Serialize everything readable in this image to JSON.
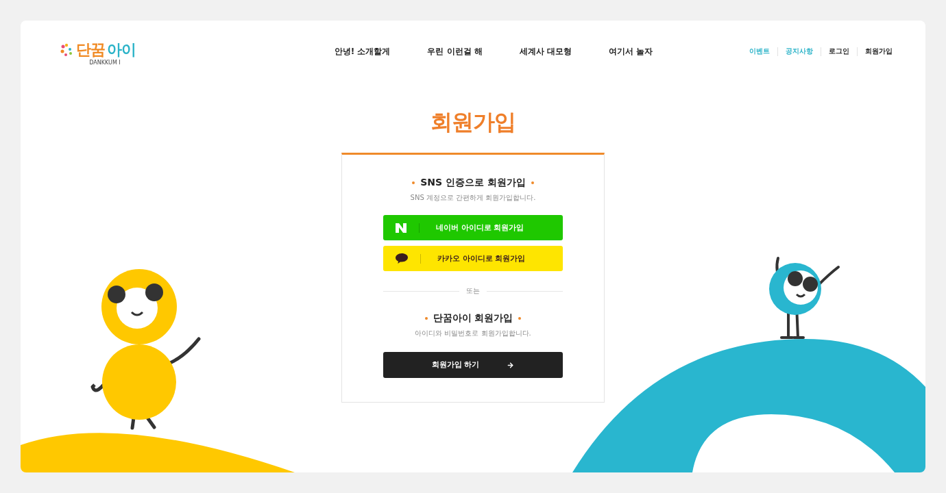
{
  "logo": {
    "word_1": "단꿈",
    "word_2": "아이",
    "sub": "DANKKUM I"
  },
  "nav": [
    "안녕! 소개할게",
    "우린 이런걸 해",
    "세계사 대모형",
    "여기서 놀자"
  ],
  "util_links": [
    {
      "label": "이벤트",
      "color": "#2bb3c8"
    },
    {
      "label": "공지사항",
      "color": "#2bb3c8"
    },
    {
      "label": "로그인",
      "color": "#222222"
    },
    {
      "label": "회원가입",
      "color": "#222222"
    }
  ],
  "page_title": "회원가입",
  "sns_section": {
    "title": "SNS 인증으로 회원가입",
    "description": "SNS 계정으로 간편하게 회원가입합니다.",
    "buttons": [
      {
        "kind": "naver",
        "label": "네이버 아이디로 회원가입"
      },
      {
        "kind": "kakao",
        "label": "카카오 아이디로 회원가입"
      }
    ]
  },
  "divider_text": "또는",
  "member_section": {
    "title": "단꿈아이 회원가입",
    "description": "아이디와 비밀번호로 회원가입합니다.",
    "button": "회원가입 하기"
  }
}
